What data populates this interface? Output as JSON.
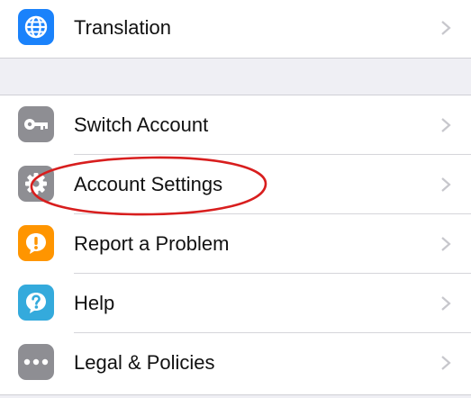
{
  "colors": {
    "translation_icon_bg": "#1a82fb",
    "switch_account_icon_bg": "#8e8e93",
    "account_settings_icon_bg": "#8e8e93",
    "report_problem_icon_bg": "#ff9500",
    "help_icon_bg": "#34aadc",
    "legal_icon_bg": "#8e8e93",
    "highlight_ellipse": "#d81e1e",
    "chevron": "#c7c7cc"
  },
  "menu": {
    "translation": {
      "label": "Translation",
      "icon": "globe-icon"
    },
    "items": [
      {
        "label": "Switch Account",
        "icon": "key-icon"
      },
      {
        "label": "Account Settings",
        "icon": "gear-icon",
        "highlighted": true
      },
      {
        "label": "Report a Problem",
        "icon": "exclamation-icon"
      },
      {
        "label": "Help",
        "icon": "question-icon"
      },
      {
        "label": "Legal & Policies",
        "icon": "ellipsis-icon"
      }
    ]
  }
}
